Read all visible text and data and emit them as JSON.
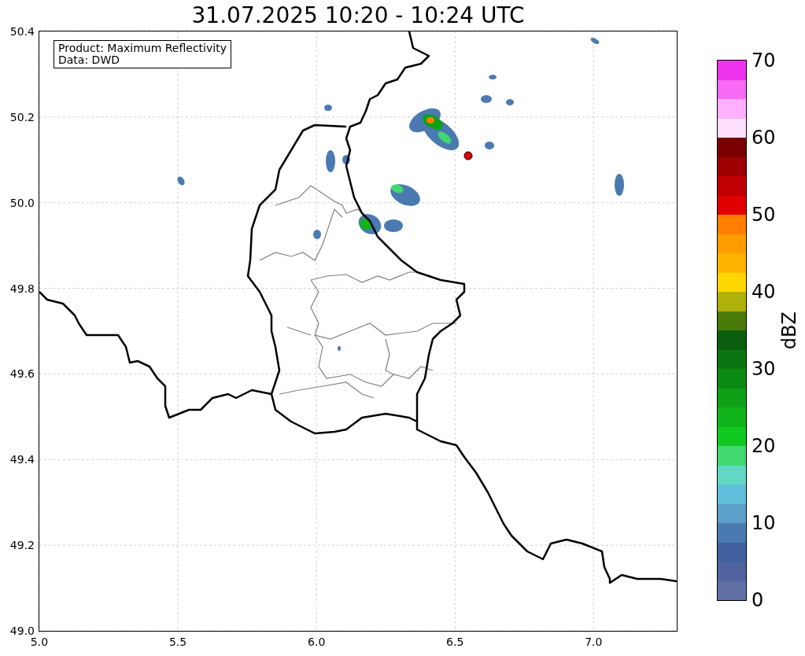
{
  "title": "31.07.2025 10:20 - 10:24 UTC",
  "info_box": [
    "Product: Maximum Reflectivity",
    "Data: DWD"
  ],
  "x_ticks": [
    "5.0",
    "5.5",
    "6.0",
    "6.5",
    "7.0"
  ],
  "y_ticks": [
    "50.4",
    "50.2",
    "50.0",
    "49.8",
    "49.6",
    "49.4",
    "49.2",
    "49.0"
  ],
  "colorbar": {
    "label": "dBZ",
    "ticks": [
      "70",
      "60",
      "50",
      "40",
      "30",
      "20",
      "10",
      "0"
    ],
    "segments": [
      {
        "color": "#ee33ee"
      },
      {
        "color": "#f76bf7"
      },
      {
        "color": "#ffb0ff"
      },
      {
        "color": "#ffe0ff"
      },
      {
        "color": "#780000"
      },
      {
        "color": "#9c0000"
      },
      {
        "color": "#c00000"
      },
      {
        "color": "#e00000"
      },
      {
        "color": "#ff7f00"
      },
      {
        "color": "#ff9c00"
      },
      {
        "color": "#ffb400"
      },
      {
        "color": "#ffd700"
      },
      {
        "color": "#b0b00a"
      },
      {
        "color": "#4a7a0a"
      },
      {
        "color": "#0a5e0e"
      },
      {
        "color": "#0a7510"
      },
      {
        "color": "#0a8a12"
      },
      {
        "color": "#10a018"
      },
      {
        "color": "#10b41a"
      },
      {
        "color": "#10c820"
      },
      {
        "color": "#40d870"
      },
      {
        "color": "#60d8c4"
      },
      {
        "color": "#60c0dc"
      },
      {
        "color": "#5aa0c8"
      },
      {
        "color": "#4a7ab0"
      },
      {
        "color": "#4060a0"
      },
      {
        "color": "#50649f"
      },
      {
        "color": "#6070a5"
      }
    ]
  }
}
